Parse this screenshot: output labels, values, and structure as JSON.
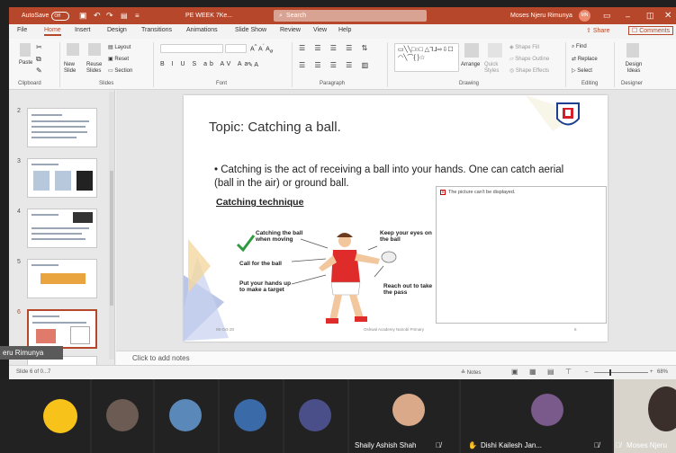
{
  "titlebar": {
    "autosave_label": "AutoSave",
    "autosave_state": "Off",
    "filename": "PE WEEK 7Ke... ",
    "search_placeholder": "Search",
    "user_name": "Moses Njeru Rimunya",
    "user_initials": "MN"
  },
  "menu": {
    "tabs": [
      "File",
      "Home",
      "Insert",
      "Design",
      "Transitions",
      "Animations",
      "Slide Show",
      "Review",
      "View",
      "Help"
    ],
    "share": "Share",
    "comments": "Comments"
  },
  "ribbon": {
    "paste": "Paste",
    "new_slide": "New Slide",
    "reuse_slides": "Reuse Slides",
    "layout": "Layout",
    "reset": "Reset",
    "section": "Section",
    "arrange": "Arrange",
    "quick_styles": "Quick Styles",
    "shape_fill": "Shape Fill",
    "shape_outline": "Shape Outline",
    "shape_effects": "Shape Effects",
    "find": "Find",
    "replace": "Replace",
    "select": "Select",
    "design_ideas": "Design Ideas",
    "groups": [
      "Clipboard",
      "Slides",
      "Font",
      "Paragraph",
      "Drawing",
      "Editing",
      "Designer"
    ]
  },
  "thumbnails": [
    "2",
    "3",
    "4",
    "5",
    "6"
  ],
  "slide": {
    "title": "Topic: Catching a ball.",
    "bullet": "Catching is the act of receiving a ball into your hands. One can catch aerial (ball in the air) or ground ball.",
    "technique_heading": "Catching technique",
    "labels": {
      "catching_moving": "Catching the ball when moving",
      "call_ball": "Call for the ball",
      "put_hands": "Put your hands up to make a target",
      "keep_eyes": "Keep your eyes on the ball",
      "reach_out": "Reach out to take the pass"
    },
    "image_error": "The picture can't be displayed.",
    "footer_date": "06-Oct-20",
    "footer_text": "Oshwal Academy Nairobi Primary",
    "footer_num": "6"
  },
  "notes_placeholder": "Click to add notes",
  "status": {
    "slide_info": "Slide 6 of 0...7",
    "notes_btn": "Notes",
    "zoom": "68%"
  },
  "overlay_name": "eru Rimunya",
  "participants": [
    {
      "name": "Shaily Ashish Shah"
    },
    {
      "name": "Dishi Kailesh Jan..."
    },
    {
      "name": "Moses Njeru"
    }
  ],
  "colors": {
    "accent": "#b7472a",
    "slide_bg": "#ffffff",
    "meeting_bg": "#2b2b2b"
  }
}
